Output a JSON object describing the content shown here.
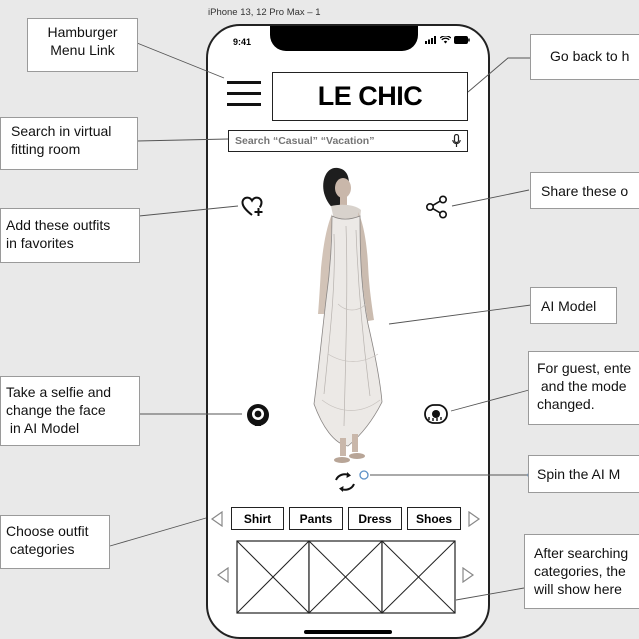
{
  "frame": {
    "label": "iPhone 13, 12 Pro Max – 1"
  },
  "status_bar": {
    "time": "9:41"
  },
  "app": {
    "logo": "LE CHIC",
    "search_placeholder": "Search “Casual” “Vacation”",
    "categories": [
      "Shirt",
      "Pants",
      "Dress",
      "Shoes"
    ]
  },
  "callouts": {
    "hamburger": [
      "Hamburger",
      "Menu Link"
    ],
    "go_back": "Go back to h",
    "search": [
      "Search in virtual",
      "fitting room"
    ],
    "share": "Share these o",
    "favorites": [
      "Add these outfits",
      "in favorites"
    ],
    "ai_model": "AI Model",
    "guest": [
      "For guest, ente",
      " and the mode",
      "changed."
    ],
    "selfie": [
      "Take a selfie and",
      "change the face",
      " in AI Model"
    ],
    "spin": "Spin the AI M",
    "categories": [
      "Choose outfit",
      " categories"
    ],
    "after_search": [
      "After searching",
      "categories, the",
      "will show here"
    ]
  },
  "icons": [
    "hamburger-menu-icon",
    "heart-plus-icon",
    "share-icon",
    "camera-face-icon",
    "measuring-tape-icon",
    "rotate-icon",
    "microphone-icon",
    "arrow-left-icon",
    "arrow-right-icon"
  ]
}
